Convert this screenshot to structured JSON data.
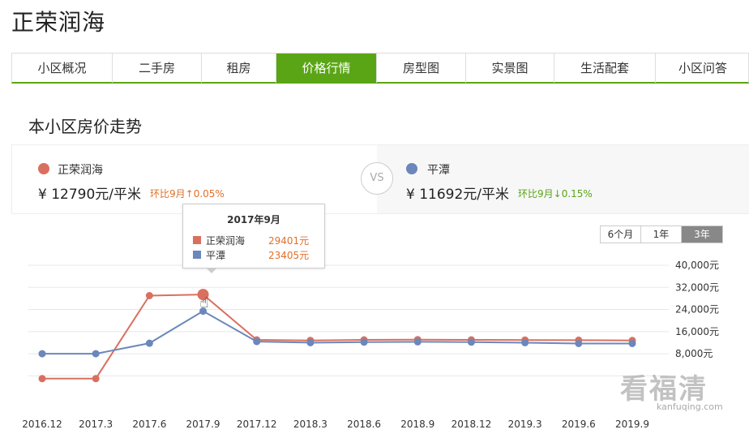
{
  "page": {
    "title": "正荣润海",
    "section_title": "本小区房价走势"
  },
  "tabs": [
    {
      "label": "小区概况",
      "active": false
    },
    {
      "label": "二手房",
      "active": false
    },
    {
      "label": "租房",
      "active": false
    },
    {
      "label": "价格行情",
      "active": true
    },
    {
      "label": "房型图",
      "active": false
    },
    {
      "label": "实景图",
      "active": false
    },
    {
      "label": "生活配套",
      "active": false
    },
    {
      "label": "小区问答",
      "active": false
    }
  ],
  "compare": {
    "left": {
      "name": "正荣润海",
      "price": "¥  12790元/平米",
      "change": "环比9月↑0.05%",
      "color": "#d9705f",
      "change_color": "#e0702a"
    },
    "vs": "VS",
    "right": {
      "name": "平潭",
      "price": "¥  11692元/平米",
      "change": "环比9月↓0.15%",
      "color": "#6b87bb",
      "change_color": "#5aa516"
    }
  },
  "range_buttons": [
    {
      "label": "6个月",
      "selected": false
    },
    {
      "label": "1年",
      "selected": false
    },
    {
      "label": "3年",
      "selected": true
    }
  ],
  "tooltip": {
    "title": "2017年9月",
    "rows": [
      {
        "name": "正荣润海",
        "value": "29401元",
        "color": "#d9705f"
      },
      {
        "name": "平潭",
        "value": "23405元",
        "color": "#6b87bb"
      }
    ]
  },
  "chart_data": {
    "type": "line",
    "x": [
      "2016.12",
      "2017.3",
      "2017.6",
      "2017.9",
      "2017.12",
      "2018.3",
      "2018.6",
      "2018.9",
      "2018.12",
      "2019.3",
      "2019.6",
      "2019.9"
    ],
    "series": [
      {
        "name": "正荣润海",
        "color": "#d9705f",
        "values": [
          -1000,
          -1000,
          29000,
          29401,
          13000,
          12800,
          13000,
          13100,
          13000,
          12950,
          12900,
          12790
        ]
      },
      {
        "name": "平潭",
        "color": "#6b87bb",
        "values": [
          8000,
          8000,
          11800,
          23405,
          12400,
          12000,
          12200,
          12300,
          12200,
          12000,
          11700,
          11692
        ]
      }
    ],
    "y_ticks": [
      "40,000元",
      "32,000元",
      "24,000元",
      "16,000元",
      "8,000元"
    ],
    "y_tick_values": [
      40000,
      32000,
      24000,
      16000,
      8000
    ],
    "ylim": [
      -4000,
      40000
    ],
    "grid": true,
    "highlight_index": 3
  },
  "watermark": {
    "main": "看福清",
    "sub": "kanfuqing.com"
  }
}
